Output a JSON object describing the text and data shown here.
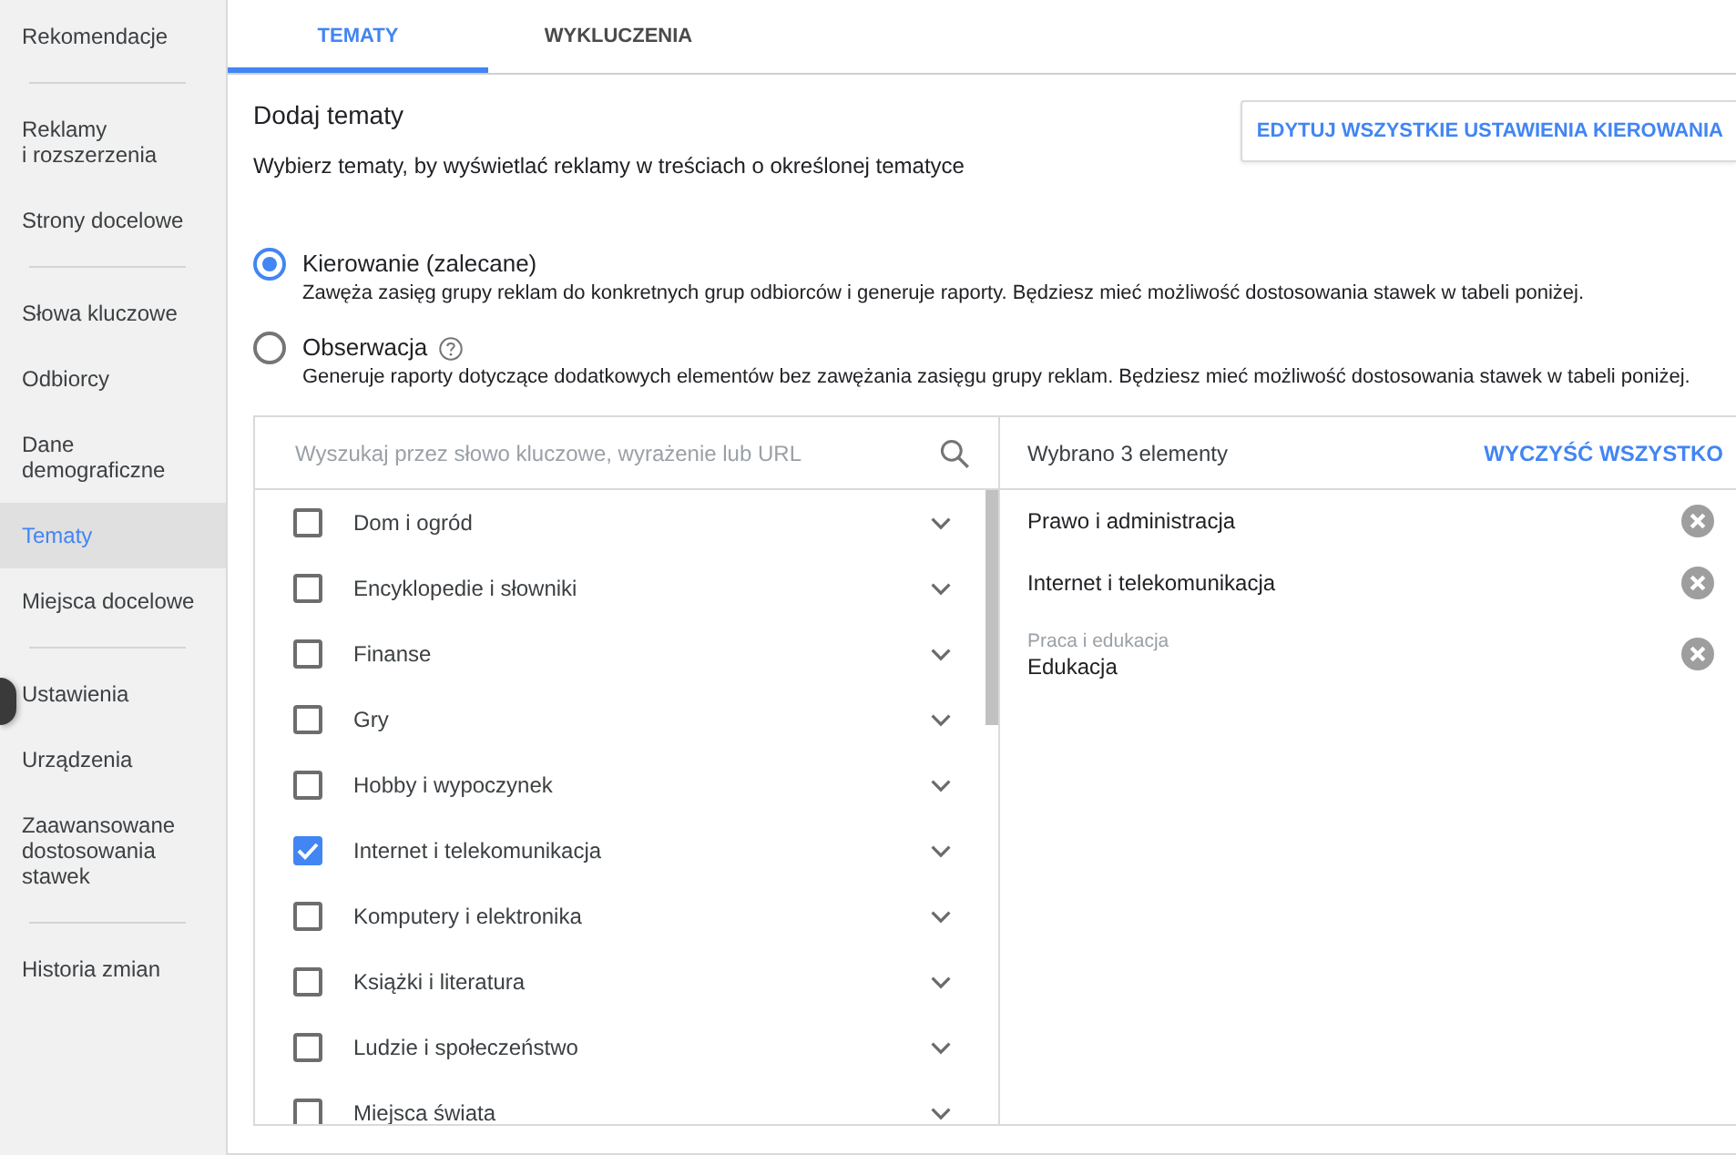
{
  "sidebar": {
    "groups": [
      {
        "items": [
          {
            "label": "Rekomendacje",
            "selected": false
          }
        ]
      },
      {
        "items": [
          {
            "label": "Reklamy\ni rozszerzenia",
            "selected": false
          },
          {
            "label": "Strony docelowe",
            "selected": false
          }
        ]
      },
      {
        "items": [
          {
            "label": "Słowa kluczowe",
            "selected": false
          },
          {
            "label": "Odbiorcy",
            "selected": false
          },
          {
            "label": "Dane\ndemograficzne",
            "selected": false
          },
          {
            "label": "Tematy",
            "selected": true
          },
          {
            "label": "Miejsca docelowe",
            "selected": false
          }
        ]
      },
      {
        "items": [
          {
            "label": "Ustawienia",
            "selected": false
          },
          {
            "label": "Urządzenia",
            "selected": false
          },
          {
            "label": "Zaawansowane\ndostosowania\nstawek",
            "selected": false
          }
        ]
      },
      {
        "items": [
          {
            "label": "Historia zmian",
            "selected": false
          }
        ]
      }
    ]
  },
  "tabs": [
    {
      "label": "TEMATY",
      "selected": true
    },
    {
      "label": "WYKLUCZENIA",
      "selected": false
    }
  ],
  "header": {
    "title": "Dodaj tematy",
    "subtitle": "Wybierz tematy, by wyświetlać reklamy w treściach o określonej tematyce",
    "edit_button": "EDYTUJ WSZYSTKIE USTAWIENIA KIEROWANIA"
  },
  "targeting_options": [
    {
      "label": "Kierowanie (zalecane)",
      "description": "Zawęża zasięg grupy reklam do konkretnych grup odbiorców i generuje raporty. Będziesz mieć możliwość dostosowania stawek w tabeli poniżej.",
      "selected": true,
      "help": false
    },
    {
      "label": "Obserwacja",
      "description": "Generuje raporty dotyczące dodatkowych elementów bez zawężania zasięgu grupy reklam. Będziesz mieć możliwość dostosowania stawek w tabeli poniżej.",
      "selected": false,
      "help": true
    }
  ],
  "topic_picker": {
    "search": {
      "placeholder": "Wyszukaj przez słowo kluczowe, wyrażenie lub URL"
    },
    "topics": [
      {
        "label": "Dom i ogród",
        "checked": false
      },
      {
        "label": "Encyklopedie i słowniki",
        "checked": false
      },
      {
        "label": "Finanse",
        "checked": false
      },
      {
        "label": "Gry",
        "checked": false
      },
      {
        "label": "Hobby i wypoczynek",
        "checked": false
      },
      {
        "label": "Internet i telekomunikacja",
        "checked": true
      },
      {
        "label": "Komputery i elektronika",
        "checked": false
      },
      {
        "label": "Książki i literatura",
        "checked": false
      },
      {
        "label": "Ludzie i społeczeństwo",
        "checked": false
      },
      {
        "label": "Miejsca świata",
        "checked": false
      }
    ],
    "selection": {
      "summary": "Wybrano 3 elementy",
      "clear_button": "WYCZYŚĆ WSZYSTKO",
      "items": [
        {
          "label": "Prawo i administracja"
        },
        {
          "label": "Internet i telekomunikacja"
        },
        {
          "category": "Praca i edukacja",
          "label": "Edukacja"
        }
      ]
    }
  }
}
